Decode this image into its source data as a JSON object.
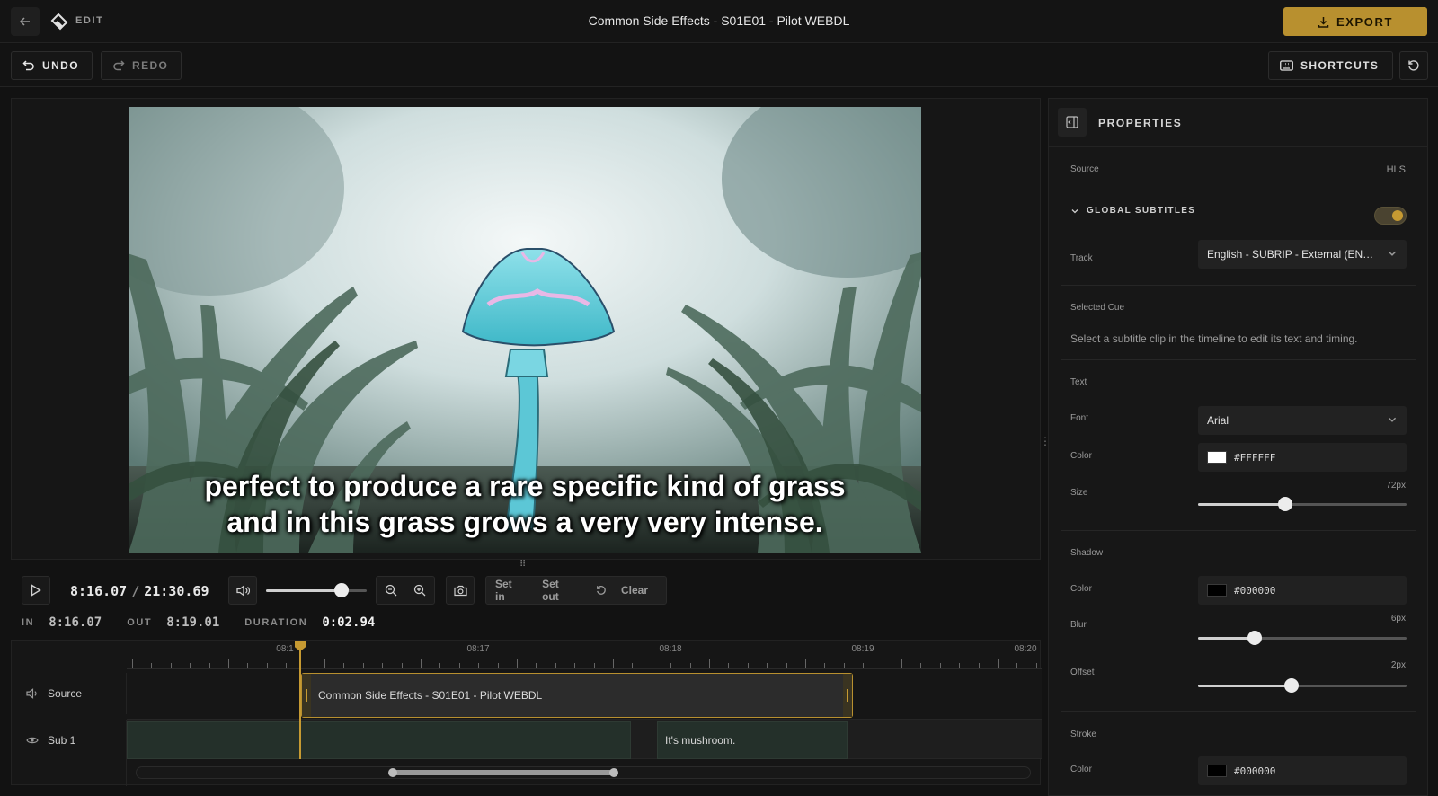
{
  "header": {
    "edit_label": "EDIT",
    "title": "Common Side Effects - S01E01 - Pilot WEBDL",
    "export_label": "EXPORT",
    "accent_color": "#b8902f"
  },
  "toolbar": {
    "undo_label": "UNDO",
    "redo_label": "REDO",
    "shortcuts_label": "SHORTCUTS"
  },
  "video": {
    "subtitle_line1": "perfect to produce a rare specific kind of grass",
    "subtitle_line2": "and in this grass grows a very very intense."
  },
  "controls": {
    "current_time": "8:16.07",
    "time_separator": "/",
    "total_time": "21:30.69",
    "volume_level": 0.75,
    "set_in_label": "Set in",
    "set_out_label": "Set out",
    "clear_label": "Clear",
    "in_label": "IN",
    "in_value": "8:16.07",
    "out_label": "OUT",
    "out_value": "8:19.01",
    "duration_label": "DURATION",
    "duration_value": "0:02.94"
  },
  "timeline": {
    "ruler_labels": [
      "08:1",
      "08:17",
      "08:18",
      "08:19",
      "08:20"
    ],
    "tracks": [
      {
        "name": "Source",
        "icon": "speaker-icon"
      },
      {
        "name": "Sub 1",
        "icon": "eye-icon"
      }
    ],
    "source_clip_label": "Common Side Effects - S01E01 - Pilot WEBDL",
    "sub_clip_label": "It's mushroom."
  },
  "properties": {
    "title": "PROPERTIES",
    "source_label": "Source",
    "source_value": "HLS",
    "global_subtitles_label": "GLOBAL SUBTITLES",
    "global_subtitles_enabled": true,
    "track_label": "Track",
    "track_value": "English - SUBRIP - External (EN…",
    "selected_cue_label": "Selected Cue",
    "selected_cue_hint": "Select a subtitle clip in the timeline to edit its text and timing.",
    "text_section": "Text",
    "font_label": "Font",
    "font_value": "Arial",
    "text_color_label": "Color",
    "text_color_value": "#FFFFFF",
    "size_label": "Size",
    "size_value": "72px",
    "size_level": 0.42,
    "shadow_section": "Shadow",
    "shadow_color_label": "Color",
    "shadow_color_value": "#000000",
    "blur_label": "Blur",
    "blur_value": "6px",
    "blur_level": 0.27,
    "offset_label": "Offset",
    "offset_value": "2px",
    "offset_level": 0.45,
    "stroke_section": "Stroke",
    "stroke_color_label": "Color",
    "stroke_color_value": "#000000"
  }
}
